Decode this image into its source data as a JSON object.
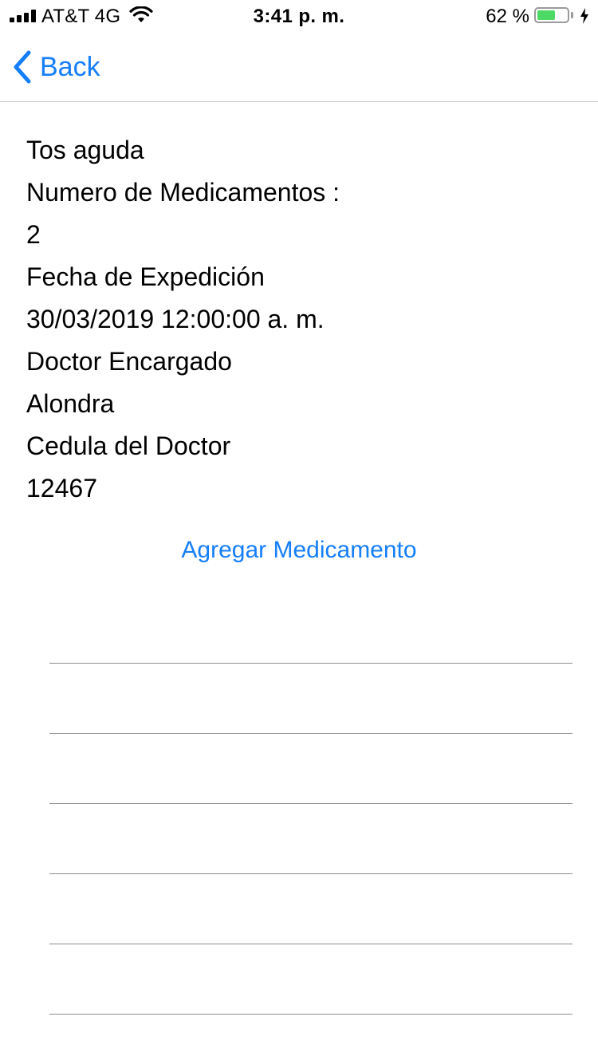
{
  "status_bar": {
    "carrier": "AT&T 4G",
    "time": "3:41 p. m.",
    "battery_percent_label": "62 %",
    "battery_level": 0.62,
    "signal_icon": "signal-bars-icon",
    "wifi_icon": "wifi-icon",
    "battery_icon": "battery-icon",
    "charging_icon": "charging-bolt-icon"
  },
  "nav": {
    "back_label": "Back",
    "back_icon": "chevron-left-icon"
  },
  "prescription": {
    "diagnosis": "Tos aguda",
    "medication_count_label": "Numero de Medicamentos :",
    "medication_count": "2",
    "issue_date_label": "Fecha de Expedición",
    "issue_date": "30/03/2019 12:00:00 a. m.",
    "doctor_label": "Doctor Encargado",
    "doctor_name": "Alondra",
    "doctor_id_label": "Cedula del Doctor",
    "doctor_id": "12467"
  },
  "actions": {
    "add_medication_label": "Agregar Medicamento"
  },
  "medication_list": {
    "rows": [
      "",
      "",
      "",
      "",
      "",
      ""
    ]
  },
  "colors": {
    "accent": "#157efb",
    "battery": "#4cd964",
    "separator": "#8e8e93"
  }
}
